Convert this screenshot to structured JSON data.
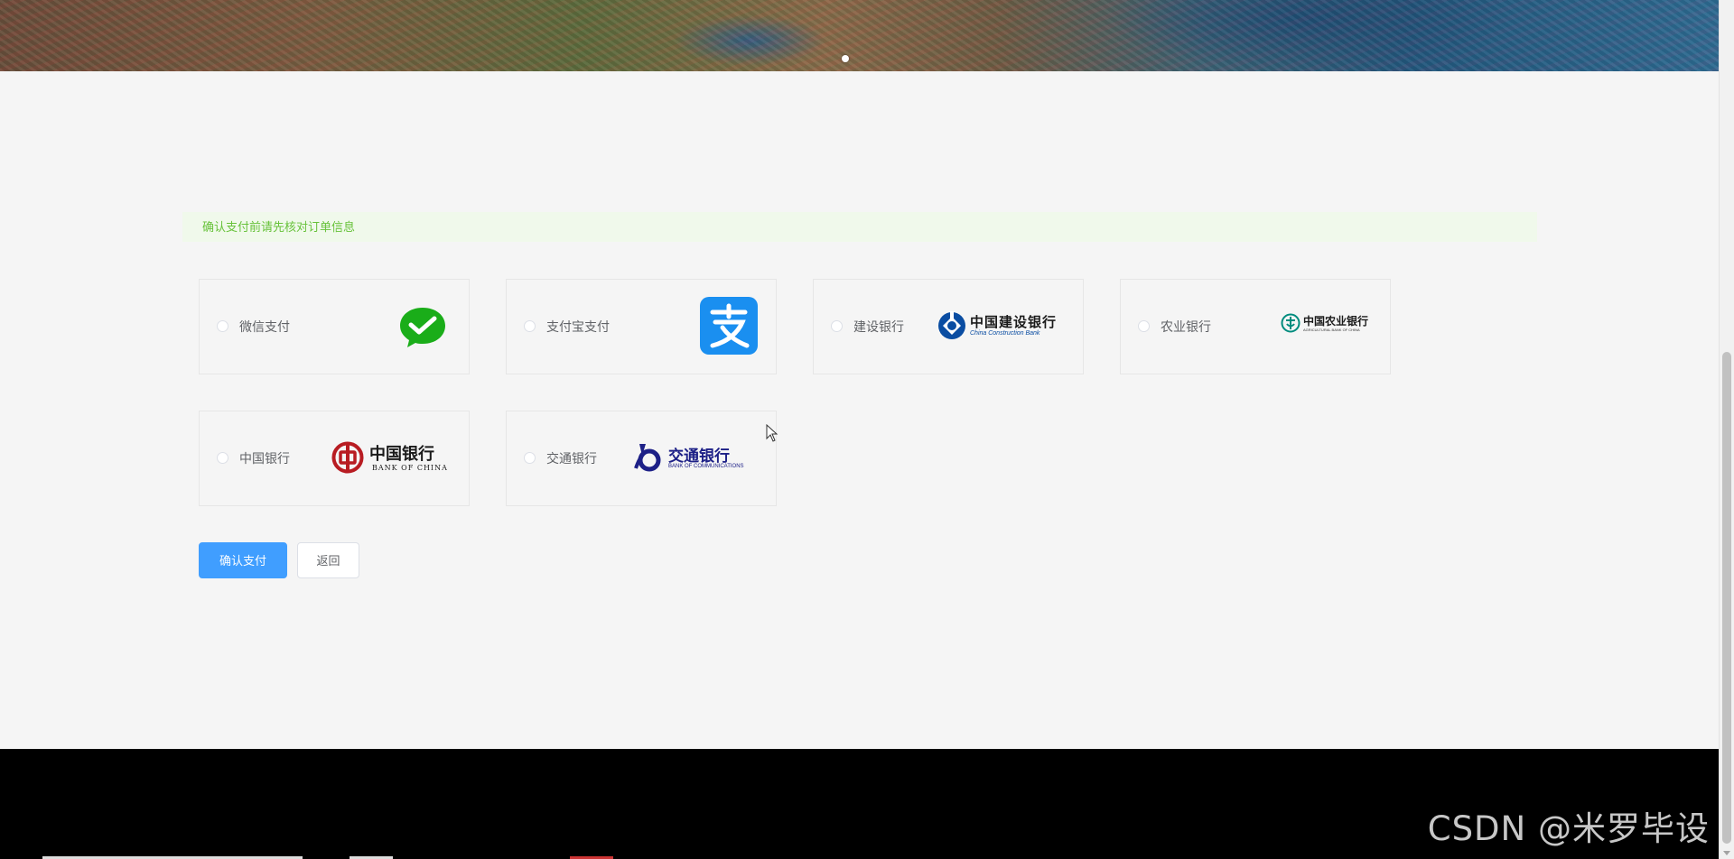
{
  "notice": {
    "text": "确认支付前请先核对订单信息"
  },
  "payment_methods": [
    {
      "label": "微信支付",
      "logo": "wechat-pay-logo"
    },
    {
      "label": "支付宝支付",
      "logo": "alipay-logo"
    },
    {
      "label": "建设银行",
      "logo": "ccb-logo",
      "logo_text": "中国建设银行",
      "logo_subtext": "China Construction Bank"
    },
    {
      "label": "农业银行",
      "logo": "abc-logo",
      "logo_text": "中国农业银行",
      "logo_subtext": "AGRICULTURAL BANK OF CHINA"
    },
    {
      "label": "中国银行",
      "logo": "boc-logo",
      "logo_text": "中国银行",
      "logo_subtext": "BANK OF CHINA"
    },
    {
      "label": "交通银行",
      "logo": "bocom-logo",
      "logo_text": "交通银行",
      "logo_subtext": "BANK OF COMMUNICATIONS"
    }
  ],
  "actions": {
    "confirm_label": "确认支付",
    "back_label": "返回"
  },
  "watermark": "CSDN @米罗毕设",
  "colors": {
    "primary": "#409eff",
    "notice_bg": "#f0f9eb",
    "notice_text": "#67c23a",
    "wechat": "#1aad19",
    "alipay": "#1677ff",
    "ccb": "#0a4da2",
    "abc": "#008c7e",
    "boc": "#b81c22",
    "bocom": "#1d2087"
  }
}
